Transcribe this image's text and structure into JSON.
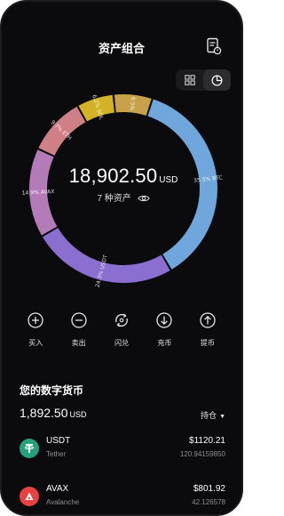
{
  "header": {
    "title": "资产组合"
  },
  "portfolio": {
    "total_amount": "18,902.50",
    "total_currency": "USD",
    "asset_count_text": "7 种资产"
  },
  "chart_data": {
    "type": "pie",
    "style": "donut",
    "slices": [
      {
        "label": "35.5% BTC",
        "value": 35.5,
        "color": "#6fa6dc"
      },
      {
        "label": "24.3% USDT",
        "value": 24.3,
        "color": "#8a6fd0"
      },
      {
        "label": "14.9% AVAX",
        "value": 14.9,
        "color": "#b57bb8"
      },
      {
        "label": "9.7% ETH",
        "value": 9.7,
        "color": "#cf7f86"
      },
      {
        "label": "6.2% SOL",
        "value": 6.2,
        "color": "#d4b227"
      },
      {
        "label": "6.5%",
        "value": 6.5,
        "color": "#c8a24a"
      }
    ]
  },
  "actions": [
    {
      "label": "买入",
      "icon": "plus-circle-icon"
    },
    {
      "label": "卖出",
      "icon": "minus-circle-icon"
    },
    {
      "label": "闪兑",
      "icon": "swap-icon"
    },
    {
      "label": "充币",
      "icon": "deposit-icon"
    },
    {
      "label": "提币",
      "icon": "withdraw-icon"
    }
  ],
  "holdings": {
    "title": "您的数字货币",
    "total_value": "1,892.50",
    "total_currency": "USD",
    "sort_label": "持仓",
    "coins": [
      {
        "symbol": "USDT",
        "name": "Tether",
        "value": "$1120.21",
        "amount": "120.94159850",
        "color": "#26a17b"
      },
      {
        "symbol": "AVAX",
        "name": "Avalanche",
        "value": "$801.92",
        "amount": "42.126578",
        "color": "#e84142"
      }
    ]
  },
  "colors": {
    "background": "#0b0b0d",
    "text_secondary": "#8e8e93"
  }
}
